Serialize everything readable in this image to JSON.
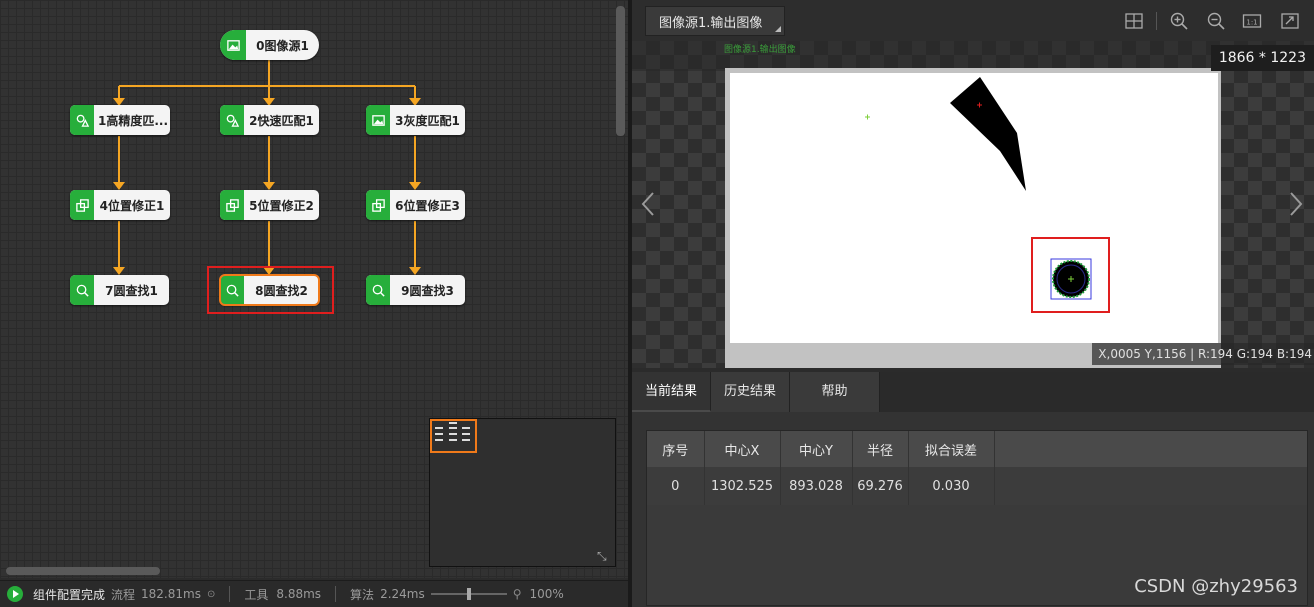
{
  "flow": {
    "nodes": [
      {
        "id": "n0",
        "label": "0图像源1",
        "icon": "image-icon"
      },
      {
        "id": "n1",
        "label": "1高精度匹...",
        "icon": "match-icon"
      },
      {
        "id": "n2",
        "label": "2快速匹配1",
        "icon": "match-icon"
      },
      {
        "id": "n3",
        "label": "3灰度匹配1",
        "icon": "image-icon"
      },
      {
        "id": "n4",
        "label": "4位置修正1",
        "icon": "position-fix-icon"
      },
      {
        "id": "n5",
        "label": "5位置修正2",
        "icon": "position-fix-icon"
      },
      {
        "id": "n6",
        "label": "6位置修正3",
        "icon": "position-fix-icon"
      },
      {
        "id": "n7",
        "label": "7圆查找1",
        "icon": "circle-find-icon"
      },
      {
        "id": "n8",
        "label": "8圆查找2",
        "icon": "circle-find-icon"
      },
      {
        "id": "n9",
        "label": "9圆查找3",
        "icon": "circle-find-icon"
      }
    ],
    "selected": "8圆查找2"
  },
  "status_bar": {
    "status": "组件配置完成",
    "flow_label": "流程",
    "flow_time": "182.81ms",
    "tool_label": "工具",
    "tool_time": "8.88ms",
    "algo_label": "算法",
    "algo_time": "2.24ms",
    "zoom": "100%",
    "zoom_level": 0.5
  },
  "image_toolbar": {
    "source": "图像源1.输出图像",
    "icons": [
      "grid-icon",
      "zoom-in-icon",
      "zoom-out-icon",
      "actual-size-icon",
      "fit-window-icon"
    ]
  },
  "image_view": {
    "size": "1866 * 1223",
    "pixel_info": "X,0005  Y,1156  |  R:194  G:194  B:194",
    "tag": "图像源1.输出图像"
  },
  "results": {
    "tabs": [
      "当前结果",
      "历史结果",
      "帮助"
    ],
    "active_tab": "当前结果",
    "columns": [
      "序号",
      "中心X",
      "中心Y",
      "半径",
      "拟合误差"
    ],
    "rows": [
      [
        "0",
        "1302.525",
        "893.028",
        "69.276",
        "0.030"
      ]
    ]
  },
  "watermark": "CSDN @zhy29563",
  "colors": {
    "node_icon_bg": "#27ae3b",
    "connector": "#f5a623",
    "highlight": "#e01e1e",
    "selected_outline": "#f07a1a"
  }
}
